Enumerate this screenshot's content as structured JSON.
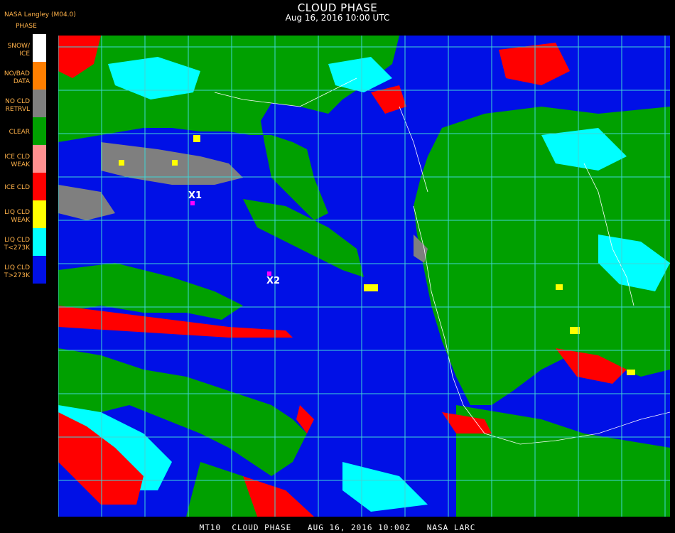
{
  "header": {
    "title": "CLOUD PHASE",
    "subtitle": "Aug 16, 2016 10:00 UTC",
    "org": "NASA Langley (M04.0)",
    "legend_title": "PHASE"
  },
  "legend": [
    {
      "label": "SNOW/\nICE",
      "color": "#ffffff"
    },
    {
      "label": "NO/BAD\nDATA",
      "color": "#ff7f00"
    },
    {
      "label": "NO CLD\nRETRVL",
      "color": "#7f7f7f"
    },
    {
      "label": "CLEAR",
      "color": "#00a000"
    },
    {
      "label": "ICE CLD\nWEAK",
      "color": "#ff9090"
    },
    {
      "label": "ICE CLD",
      "color": "#ff0000"
    },
    {
      "label": "LIQ CLD\nWEAK",
      "color": "#ffff00"
    },
    {
      "label": "LIQ CLD\nT<273K",
      "color": "#00ffff"
    },
    {
      "label": "LIQ CLD\nT>273K",
      "color": "#0010e6"
    }
  ],
  "markers": [
    {
      "label": "X1"
    },
    {
      "label": "X2"
    }
  ],
  "colors": {
    "grid": "#3fd6d6",
    "marker": "#ff00ff",
    "legend_text": "#ffb24a"
  },
  "footer": "MT10  CLOUD PHASE   AUG 16, 2016 10:00Z   NASA LARC"
}
